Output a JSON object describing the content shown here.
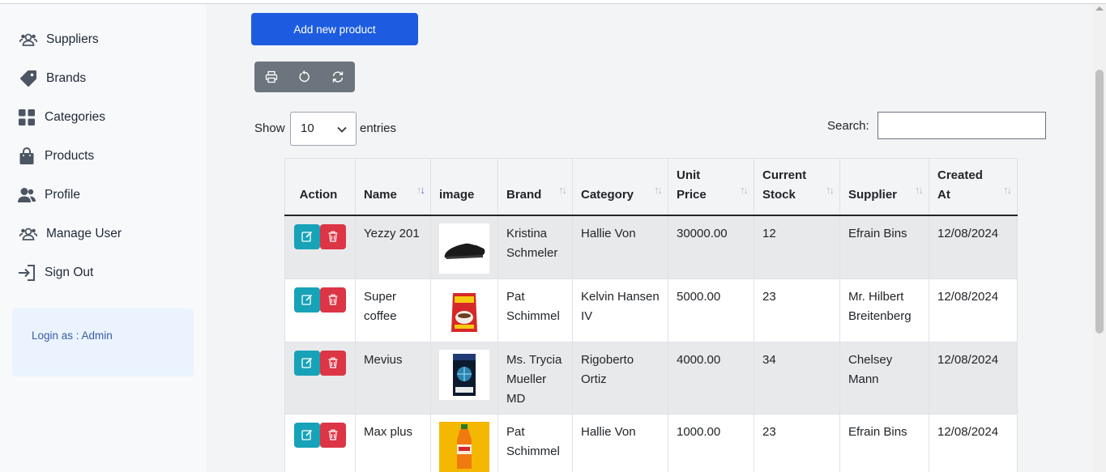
{
  "sidebar": {
    "items": [
      {
        "label": "Suppliers",
        "icon": "users-group-icon"
      },
      {
        "label": "Brands",
        "icon": "tag-icon"
      },
      {
        "label": "Categories",
        "icon": "grid-icon"
      },
      {
        "label": "Products",
        "icon": "shopping-bag-icon"
      },
      {
        "label": "Profile",
        "icon": "user-icon"
      },
      {
        "label": "Manage User",
        "icon": "users-group-icon"
      },
      {
        "label": "Sign Out",
        "icon": "sign-out-icon"
      }
    ],
    "login_text": "Login as : Admin"
  },
  "main": {
    "add_button": "Add new product",
    "toolbar": [
      "print-icon",
      "undo-icon",
      "refresh-icon"
    ],
    "show_label": "Show",
    "entries_value": "10",
    "entries_label": "entries",
    "search_label": "Search:",
    "search_value": ""
  },
  "table": {
    "headers": [
      "Action",
      "Name",
      "image",
      "Brand",
      "Category",
      "Unit Price",
      "Current Stock",
      "Supplier",
      "Created At"
    ],
    "rows": [
      {
        "name": "Yezzy 201",
        "brand": "Kristina Schmeler",
        "category": "Hallie Von",
        "price": "30000.00",
        "stock": "12",
        "supplier": "Efrain Bins",
        "created": "12/08/2024",
        "image": "black sneaker"
      },
      {
        "name": "Super coffee",
        "brand": "Pat Schimmel",
        "category": "Kelvin Hansen IV",
        "price": "5000.00",
        "stock": "23",
        "supplier": "Mr. Hilbert Breitenberg",
        "created": "12/08/2024",
        "image": "coffee pack"
      },
      {
        "name": "Mevius",
        "brand": "Ms. Trycia Mueller MD",
        "category": "Rigoberto Ortiz",
        "price": "4000.00",
        "stock": "34",
        "supplier": "Chelsey Mann",
        "created": "12/08/2024",
        "image": "cigarette pack"
      },
      {
        "name": "Max plus",
        "brand": "Pat Schimmel",
        "category": "Hallie Von",
        "price": "1000.00",
        "stock": "23",
        "supplier": "Efrain Bins",
        "created": "12/08/2024",
        "image": "orange drink bottle"
      }
    ]
  },
  "colors": {
    "primary": "#1d5ce0",
    "edit": "#17a2b8",
    "delete": "#dc3545",
    "toolbar": "#6c757d"
  }
}
